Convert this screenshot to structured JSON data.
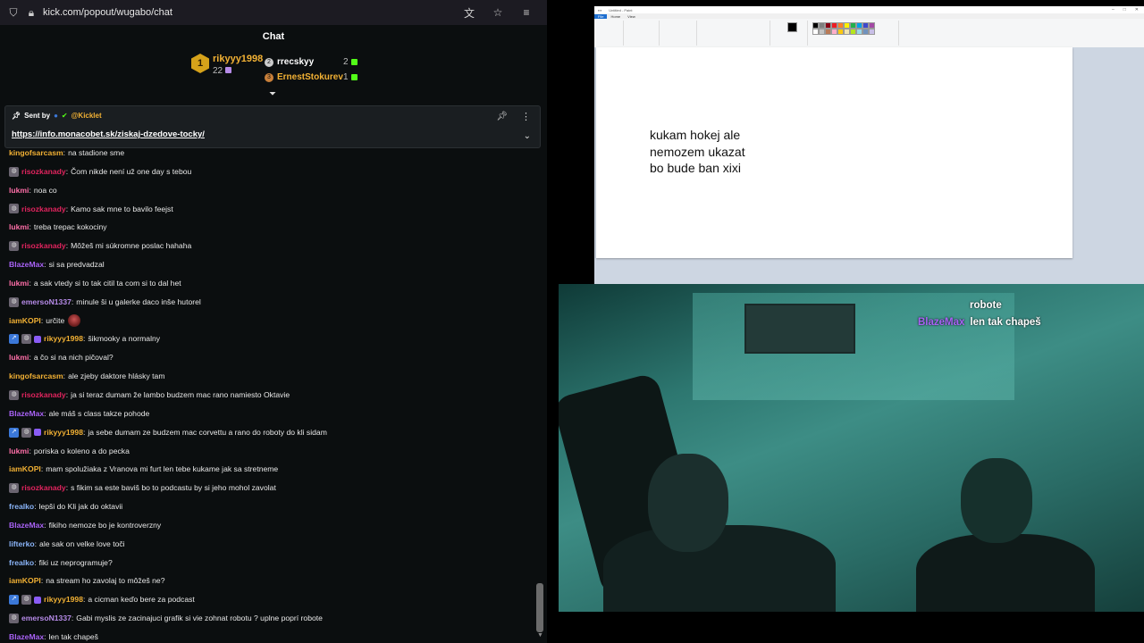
{
  "browser": {
    "url": "kick.com/popout/wugabo/chat"
  },
  "chat": {
    "header": "Chat",
    "leaderboard": {
      "first": {
        "rank": "1",
        "name": "rikyyy1998",
        "count": "22"
      },
      "others": [
        {
          "name": "rrecskyy",
          "count": "2",
          "color": "#ffffff"
        },
        {
          "name": "ErnestStokurev",
          "count": "1",
          "color": "#f2b134"
        }
      ]
    },
    "pinned": {
      "sent_by": "Sent by",
      "bot": "@Kicklet",
      "link": "https://info.monacobet.sk/ziskaj-dzedove-tocky/"
    },
    "messages": [
      {
        "user": "kingofsarcasm",
        "color": "#f2b134",
        "text": "na stadione sme",
        "badges": []
      },
      {
        "user": "risozkanady",
        "color": "#e0245e",
        "text": "Čom nikde není už one day s tebou",
        "badges": [
          "avatar"
        ]
      },
      {
        "user": "lukmi",
        "color": "#ff6fa8",
        "text": "noa co",
        "badges": []
      },
      {
        "user": "risozkanady",
        "color": "#e0245e",
        "text": "Kamo sak mne to bavilo feejst",
        "badges": [
          "avatar"
        ]
      },
      {
        "user": "lukmi",
        "color": "#ff6fa8",
        "text": "treba trepac kokociny",
        "badges": []
      },
      {
        "user": "risozkanady",
        "color": "#e0245e",
        "text": "Môžeš mi súkromne poslac hahaha",
        "badges": [
          "avatar"
        ]
      },
      {
        "user": "BlazeMax",
        "color": "#a862f5",
        "text": "si sa predvadzal",
        "badges": []
      },
      {
        "user": "lukmi",
        "color": "#ff6fa8",
        "text": "a sak vtedy si to tak citil ta com si to dal het",
        "badges": []
      },
      {
        "user": "emersoN1337",
        "color": "#b68be8",
        "text": "minule ši u galerke daco inše hutorel",
        "badges": [
          "avatar"
        ]
      },
      {
        "user": "iamKOPI",
        "color": "#f2b134",
        "text": "určite",
        "badges": []
      },
      {
        "user": "rikyyy1998",
        "color": "#f2b134",
        "text": "šikmooky a normalny",
        "badges": [
          "mod",
          "avatar",
          "sub"
        ]
      },
      {
        "user": "lukmi",
        "color": "#ff6fa8",
        "text": "a čo si na nich pičoval?",
        "badges": []
      },
      {
        "user": "kingofsarcasm",
        "color": "#f2b134",
        "text": "ale zjeby daktore hlásky tam",
        "badges": []
      },
      {
        "user": "risozkanady",
        "color": "#e0245e",
        "text": "ja si teraz dumam že lambo budzem mac rano namiesto Oktavie",
        "badges": [
          "avatar"
        ]
      },
      {
        "user": "BlazeMax",
        "color": "#a862f5",
        "text": "ale máš s class takze pohode",
        "badges": []
      },
      {
        "user": "rikyyy1998",
        "color": "#f2b134",
        "text": "ja sebe dumam ze budzem mac corvettu a rano do roboty do kli sidam",
        "badges": [
          "mod",
          "avatar",
          "sub"
        ]
      },
      {
        "user": "lukmi",
        "color": "#ff6fa8",
        "text": "poriska o koleno a do pecka",
        "badges": []
      },
      {
        "user": "iamKOPI",
        "color": "#f2b134",
        "text": "mam spolužiaka z Vranova mi furt len tebe kukame jak sa stretneme",
        "badges": []
      },
      {
        "user": "risozkanady",
        "color": "#e0245e",
        "text": "s fikim sa este baviš bo to podcastu by si jeho mohol zavolat",
        "badges": [
          "avatar"
        ]
      },
      {
        "user": "frealko",
        "color": "#8ab4f8",
        "text": "lepši do Kli jak do oktavii",
        "badges": []
      },
      {
        "user": "BlazeMax",
        "color": "#a862f5",
        "text": "fikiho nemoze bo je kontroverzny",
        "badges": []
      },
      {
        "user": "lifterko",
        "color": "#8ab4f8",
        "text": "ale sak on velke love toči",
        "badges": []
      },
      {
        "user": "frealko",
        "color": "#8ab4f8",
        "text": "fiki uz neprogramuje?",
        "badges": []
      },
      {
        "user": "iamKOPI",
        "color": "#f2b134",
        "text": "na stream ho zavolaj to môžeš ne?",
        "badges": []
      },
      {
        "user": "rikyyy1998",
        "color": "#f2b134",
        "text": "a cicman keďo bere za podcast",
        "badges": [
          "mod",
          "avatar",
          "sub"
        ]
      },
      {
        "user": "emersoN1337",
        "color": "#b68be8",
        "text": "Gabi myslis ze zacinajuci grafik si vie zohnat robotu ? uplne poprí robote",
        "badges": [
          "avatar"
        ]
      },
      {
        "user": "BlazeMax",
        "color": "#a862f5",
        "text": "len tak chapeš",
        "badges": []
      },
      {
        "user": "BlazeMax",
        "color": "#a862f5",
        "text": "",
        "badges": []
      }
    ]
  },
  "paint": {
    "text_lines": [
      "kukam hokej ale",
      "nemozem ukazat",
      "bo bude ban xixi"
    ],
    "tabs": [
      "File",
      "Home",
      "View"
    ]
  },
  "stream_overlay": {
    "line1": "robote",
    "user": "BlazeMax",
    "line2": "len tak chapeš"
  },
  "colors": {
    "chat_bg": "#0b0e0f",
    "kick_green": "#53fc18",
    "gold": "#f2b134"
  }
}
